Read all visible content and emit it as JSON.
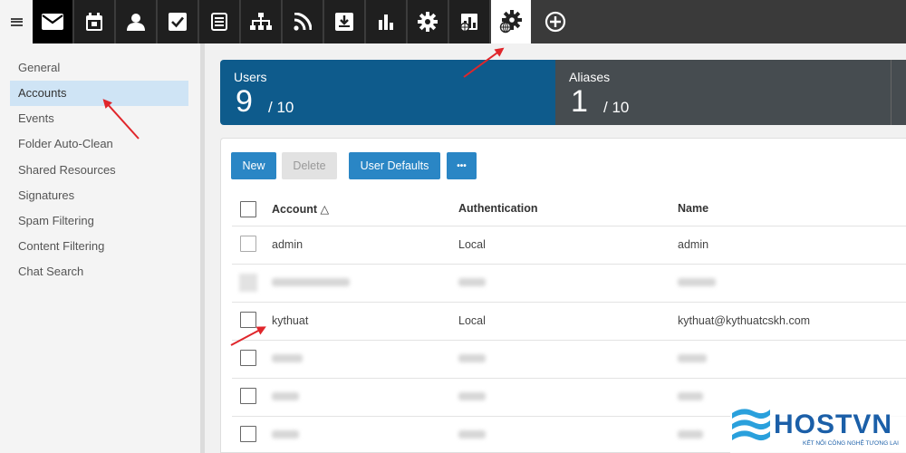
{
  "toolbar": {
    "items": [
      {
        "name": "mail-icon"
      },
      {
        "name": "calendar-icon"
      },
      {
        "name": "contacts-icon"
      },
      {
        "name": "tasks-icon"
      },
      {
        "name": "notes-icon"
      },
      {
        "name": "sitemap-icon"
      },
      {
        "name": "rss-icon"
      },
      {
        "name": "file-storage-icon"
      },
      {
        "name": "reports-icon"
      },
      {
        "name": "settings-icon"
      },
      {
        "name": "domain-reports-icon"
      },
      {
        "name": "domain-settings-icon"
      },
      {
        "name": "add-icon"
      }
    ],
    "active_item": "domain-settings-icon"
  },
  "sidebar": {
    "items": [
      {
        "label": "General"
      },
      {
        "label": "Accounts"
      },
      {
        "label": "Events"
      },
      {
        "label": "Folder Auto-Clean"
      },
      {
        "label": "Shared Resources"
      },
      {
        "label": "Signatures"
      },
      {
        "label": "Spam Filtering"
      },
      {
        "label": "Content Filtering"
      },
      {
        "label": "Chat Search"
      }
    ],
    "active": "Accounts"
  },
  "stats": {
    "users": {
      "label": "Users",
      "value": "9",
      "limit": "/ 10"
    },
    "aliases": {
      "label": "Aliases",
      "value": "1",
      "limit": "/ 10"
    }
  },
  "actions": {
    "new_label": "New",
    "delete_label": "Delete",
    "user_defaults_label": "User Defaults",
    "more_label": "•••"
  },
  "table": {
    "columns": [
      "Account △",
      "Authentication",
      "Name"
    ],
    "rows": [
      {
        "account": "admin",
        "authentication": "Local",
        "name": "admin"
      },
      {
        "account": "",
        "authentication": "",
        "name": ""
      },
      {
        "account": "kythuat",
        "authentication": "Local",
        "name": "kythuat@kythuatcskh.com"
      },
      {
        "account": "",
        "authentication": "",
        "name": ""
      },
      {
        "account": "",
        "authentication": "",
        "name": ""
      },
      {
        "account": "",
        "authentication": "",
        "name": ""
      }
    ]
  },
  "watermark": {
    "brand": "HOSTVN",
    "tagline": "KẾT NỐI CÔNG NGHỆ TƯƠNG LAI"
  },
  "colors": {
    "accent": "#2a86c5",
    "users_tile": "#0e5b8c",
    "aliases_tile": "#464c50",
    "annotation_arrow": "#e0262b"
  }
}
